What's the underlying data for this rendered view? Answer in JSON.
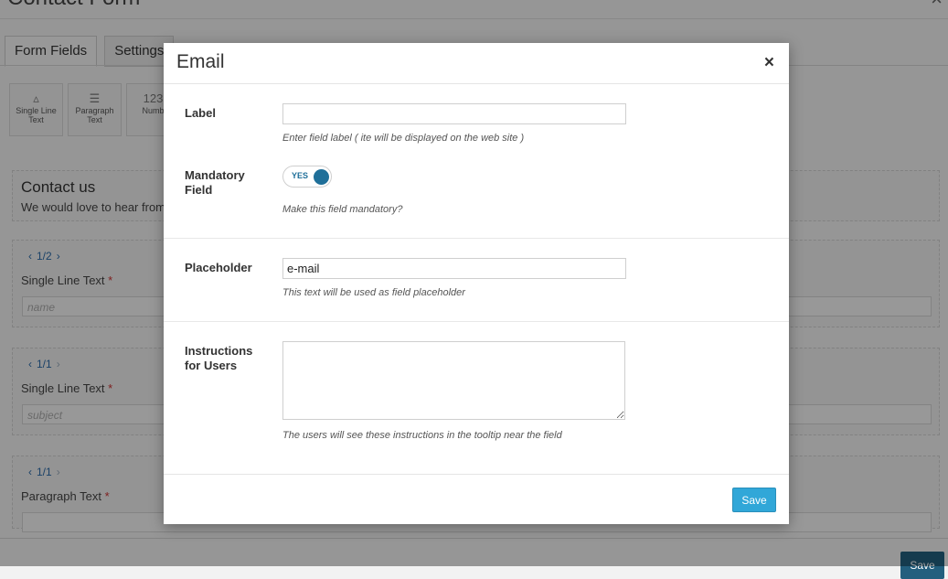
{
  "page": {
    "title": "Contact Form",
    "close_icon": "×",
    "tabs": [
      {
        "label": "Form Fields",
        "active": true
      },
      {
        "label": "Settings",
        "active": false
      }
    ],
    "tools": [
      {
        "label": "Single Line Text",
        "icon": "single-line-icon",
        "glyph": "▵"
      },
      {
        "label": "Paragraph Text",
        "icon": "paragraph-icon",
        "glyph": "☰"
      },
      {
        "label": "Numb",
        "icon": "number-icon",
        "glyph": "123"
      }
    ],
    "intro": {
      "title": "Contact us",
      "text": "We would love to hear from y"
    },
    "fields": [
      {
        "pager": "1/2",
        "label": "Single Line Text",
        "required": "*",
        "placeholder": "name"
      },
      {
        "pager": "1/1",
        "label": "Single Line Text",
        "required": "*",
        "placeholder": "subject"
      },
      {
        "pager": "1/1",
        "label": "Paragraph Text",
        "required": "*",
        "placeholder": ""
      }
    ],
    "save_label": "Save"
  },
  "modal": {
    "title": "Email",
    "close_icon": "×",
    "label_field": {
      "label": "Label",
      "value": "",
      "help": "Enter field label ( ite will be displayed on the web site )"
    },
    "mandatory_field": {
      "label": "Mandatory Field",
      "toggle_text": "YES",
      "enabled": true,
      "help": "Make this field mandatory?"
    },
    "placeholder_field": {
      "label": "Placeholder",
      "value": "e-mail",
      "help": "This text will be used as field placeholder"
    },
    "instructions_field": {
      "label": "Instructions for Users",
      "value": "",
      "help": "The users will see these instructions in the tooltip near the field"
    },
    "save_label": "Save",
    "accent_color": "#1f6f99",
    "button_color": "#31a7d8"
  }
}
